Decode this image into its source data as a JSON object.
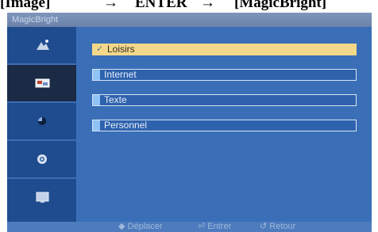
{
  "caption": {
    "left": "[Image]",
    "arrow": "→",
    "mid": "ENTER",
    "right": "[MagicBright]"
  },
  "window": {
    "title": "MagicBright"
  },
  "sidebar": {
    "items": [
      {
        "icon": "picture-icon"
      },
      {
        "icon": "screen-icon"
      },
      {
        "icon": "color-icon"
      },
      {
        "icon": "setup-icon"
      },
      {
        "icon": "information-icon"
      }
    ],
    "active_index": 1
  },
  "options": [
    {
      "label": "Loisirs",
      "selected": true
    },
    {
      "label": "Internet",
      "selected": false
    },
    {
      "label": "Texte",
      "selected": false
    },
    {
      "label": "Personnel",
      "selected": false
    }
  ],
  "footer": {
    "move": "Déplacer",
    "enter": "Entrer",
    "return": "Retour"
  },
  "colors": {
    "osd_background": "#2a5fa6",
    "selected_option": "#f4d889",
    "option_indicator": "#8fc2f5"
  }
}
